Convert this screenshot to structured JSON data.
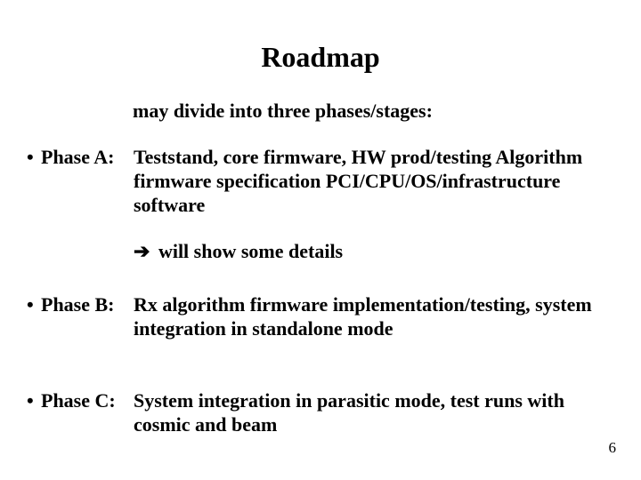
{
  "title": "Roadmap",
  "subtitle": "may divide into three phases/stages:",
  "phases": [
    {
      "label": "Phase A:",
      "body": "Teststand, core firmware, HW prod/testing Algorithm firmware specification PCI/CPU/OS/infrastructure software"
    },
    {
      "label": "Phase B:",
      "body": "Rx algorithm firmware implementation/testing, system integration in standalone mode"
    },
    {
      "label": "Phase C:",
      "body": "System integration in parasitic mode, test runs with cosmic and beam"
    }
  ],
  "detail_arrow": "➔",
  "detail_text": " will show some details",
  "bullet_char": "•",
  "page_number": "6"
}
